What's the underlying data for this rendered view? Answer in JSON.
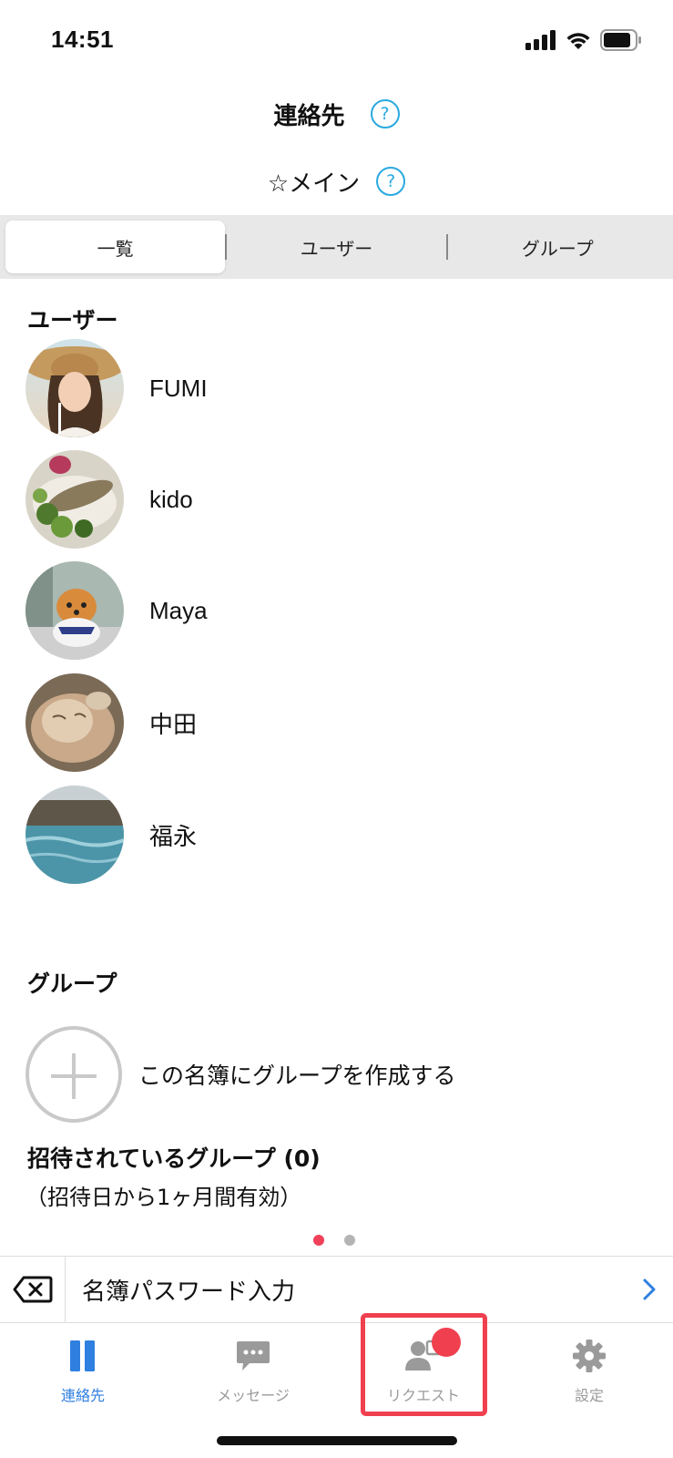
{
  "status_bar": {
    "time": "14:51"
  },
  "header": {
    "title": "連絡先",
    "subtitle": "☆メイン"
  },
  "segments": [
    "一覧",
    "ユーザー",
    "グループ"
  ],
  "users_section": {
    "label": "ユーザー"
  },
  "users": [
    {
      "name": "FUMI"
    },
    {
      "name": "kido"
    },
    {
      "name": "Maya"
    },
    {
      "name": "中田"
    },
    {
      "name": "福永"
    }
  ],
  "groups_section": {
    "label": "グループ",
    "create_label": "この名簿にグループを作成する"
  },
  "invited": {
    "title": "招待されているグループ (0)",
    "note": "（招待日から1ヶ月間有効）"
  },
  "password_bar": {
    "label": "名簿パスワード入力"
  },
  "tabs": [
    {
      "label": "連絡先",
      "icon": "contacts-icon"
    },
    {
      "label": "メッセージ",
      "icon": "message-icon"
    },
    {
      "label": "リクエスト",
      "icon": "request-icon"
    },
    {
      "label": "設定",
      "icon": "gear-icon"
    }
  ],
  "colors": {
    "accent": "#2f7fe0",
    "help": "#29a9e0",
    "highlight": "#f0404f",
    "inactive": "#9a9a9a"
  }
}
